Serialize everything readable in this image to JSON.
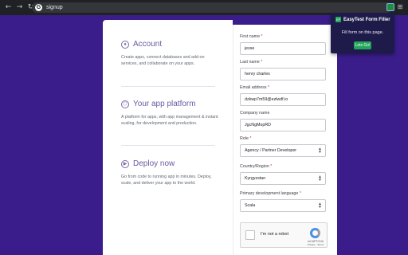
{
  "browser": {
    "url": "signup",
    "back_glyph": "←",
    "forward_glyph": "→",
    "reload_glyph": "↻",
    "search_engine_glyph": "G",
    "puzzle_glyph": "⊞"
  },
  "features": [
    {
      "icon": "user-circle-icon",
      "title": "Account",
      "description": "Create apps, connect databases and add-on services, and collaborate on your apps."
    },
    {
      "icon": "hexagon-icon",
      "title": "Your app platform",
      "description": "A platform for apps, with app management & instant scaling, for development and production."
    },
    {
      "icon": "play-circle-icon",
      "title": "Deploy now",
      "description": "Go from code to running app in minutes. Deploy, scale, and deliver your app to the world."
    }
  ],
  "form": {
    "first_name": {
      "label": "First name",
      "required": true,
      "value": "jesse"
    },
    "last_name": {
      "label": "Last name",
      "required": true,
      "value": "henry charles"
    },
    "email": {
      "label": "Email address",
      "required": true,
      "value": "dzkwp7m59@ezlwdf.io"
    },
    "company": {
      "label": "Company name",
      "required": false,
      "value": "JgcNgMopRD"
    },
    "role": {
      "label": "Role",
      "required": true,
      "value": "Agency / Partner Developer"
    },
    "country": {
      "label": "Country/Region",
      "required": true,
      "value": "Kyrgyzstan"
    },
    "language": {
      "label": "Primary development language",
      "required": true,
      "value": "Scala"
    },
    "required_mark": "*"
  },
  "captcha": {
    "label": "I'm not a robot",
    "brand": "reCAPTCHA",
    "links": "Privacy - Terms"
  },
  "extension_popup": {
    "title": "EasyTest Form Filler",
    "message": "Fill form on this page.",
    "button": "Lets Go!",
    "icon_glyph": "EF"
  },
  "colors": {
    "page_background": "#3a1d8a",
    "accent_green": "#22a55a",
    "popup_background": "#1e1b4b"
  }
}
